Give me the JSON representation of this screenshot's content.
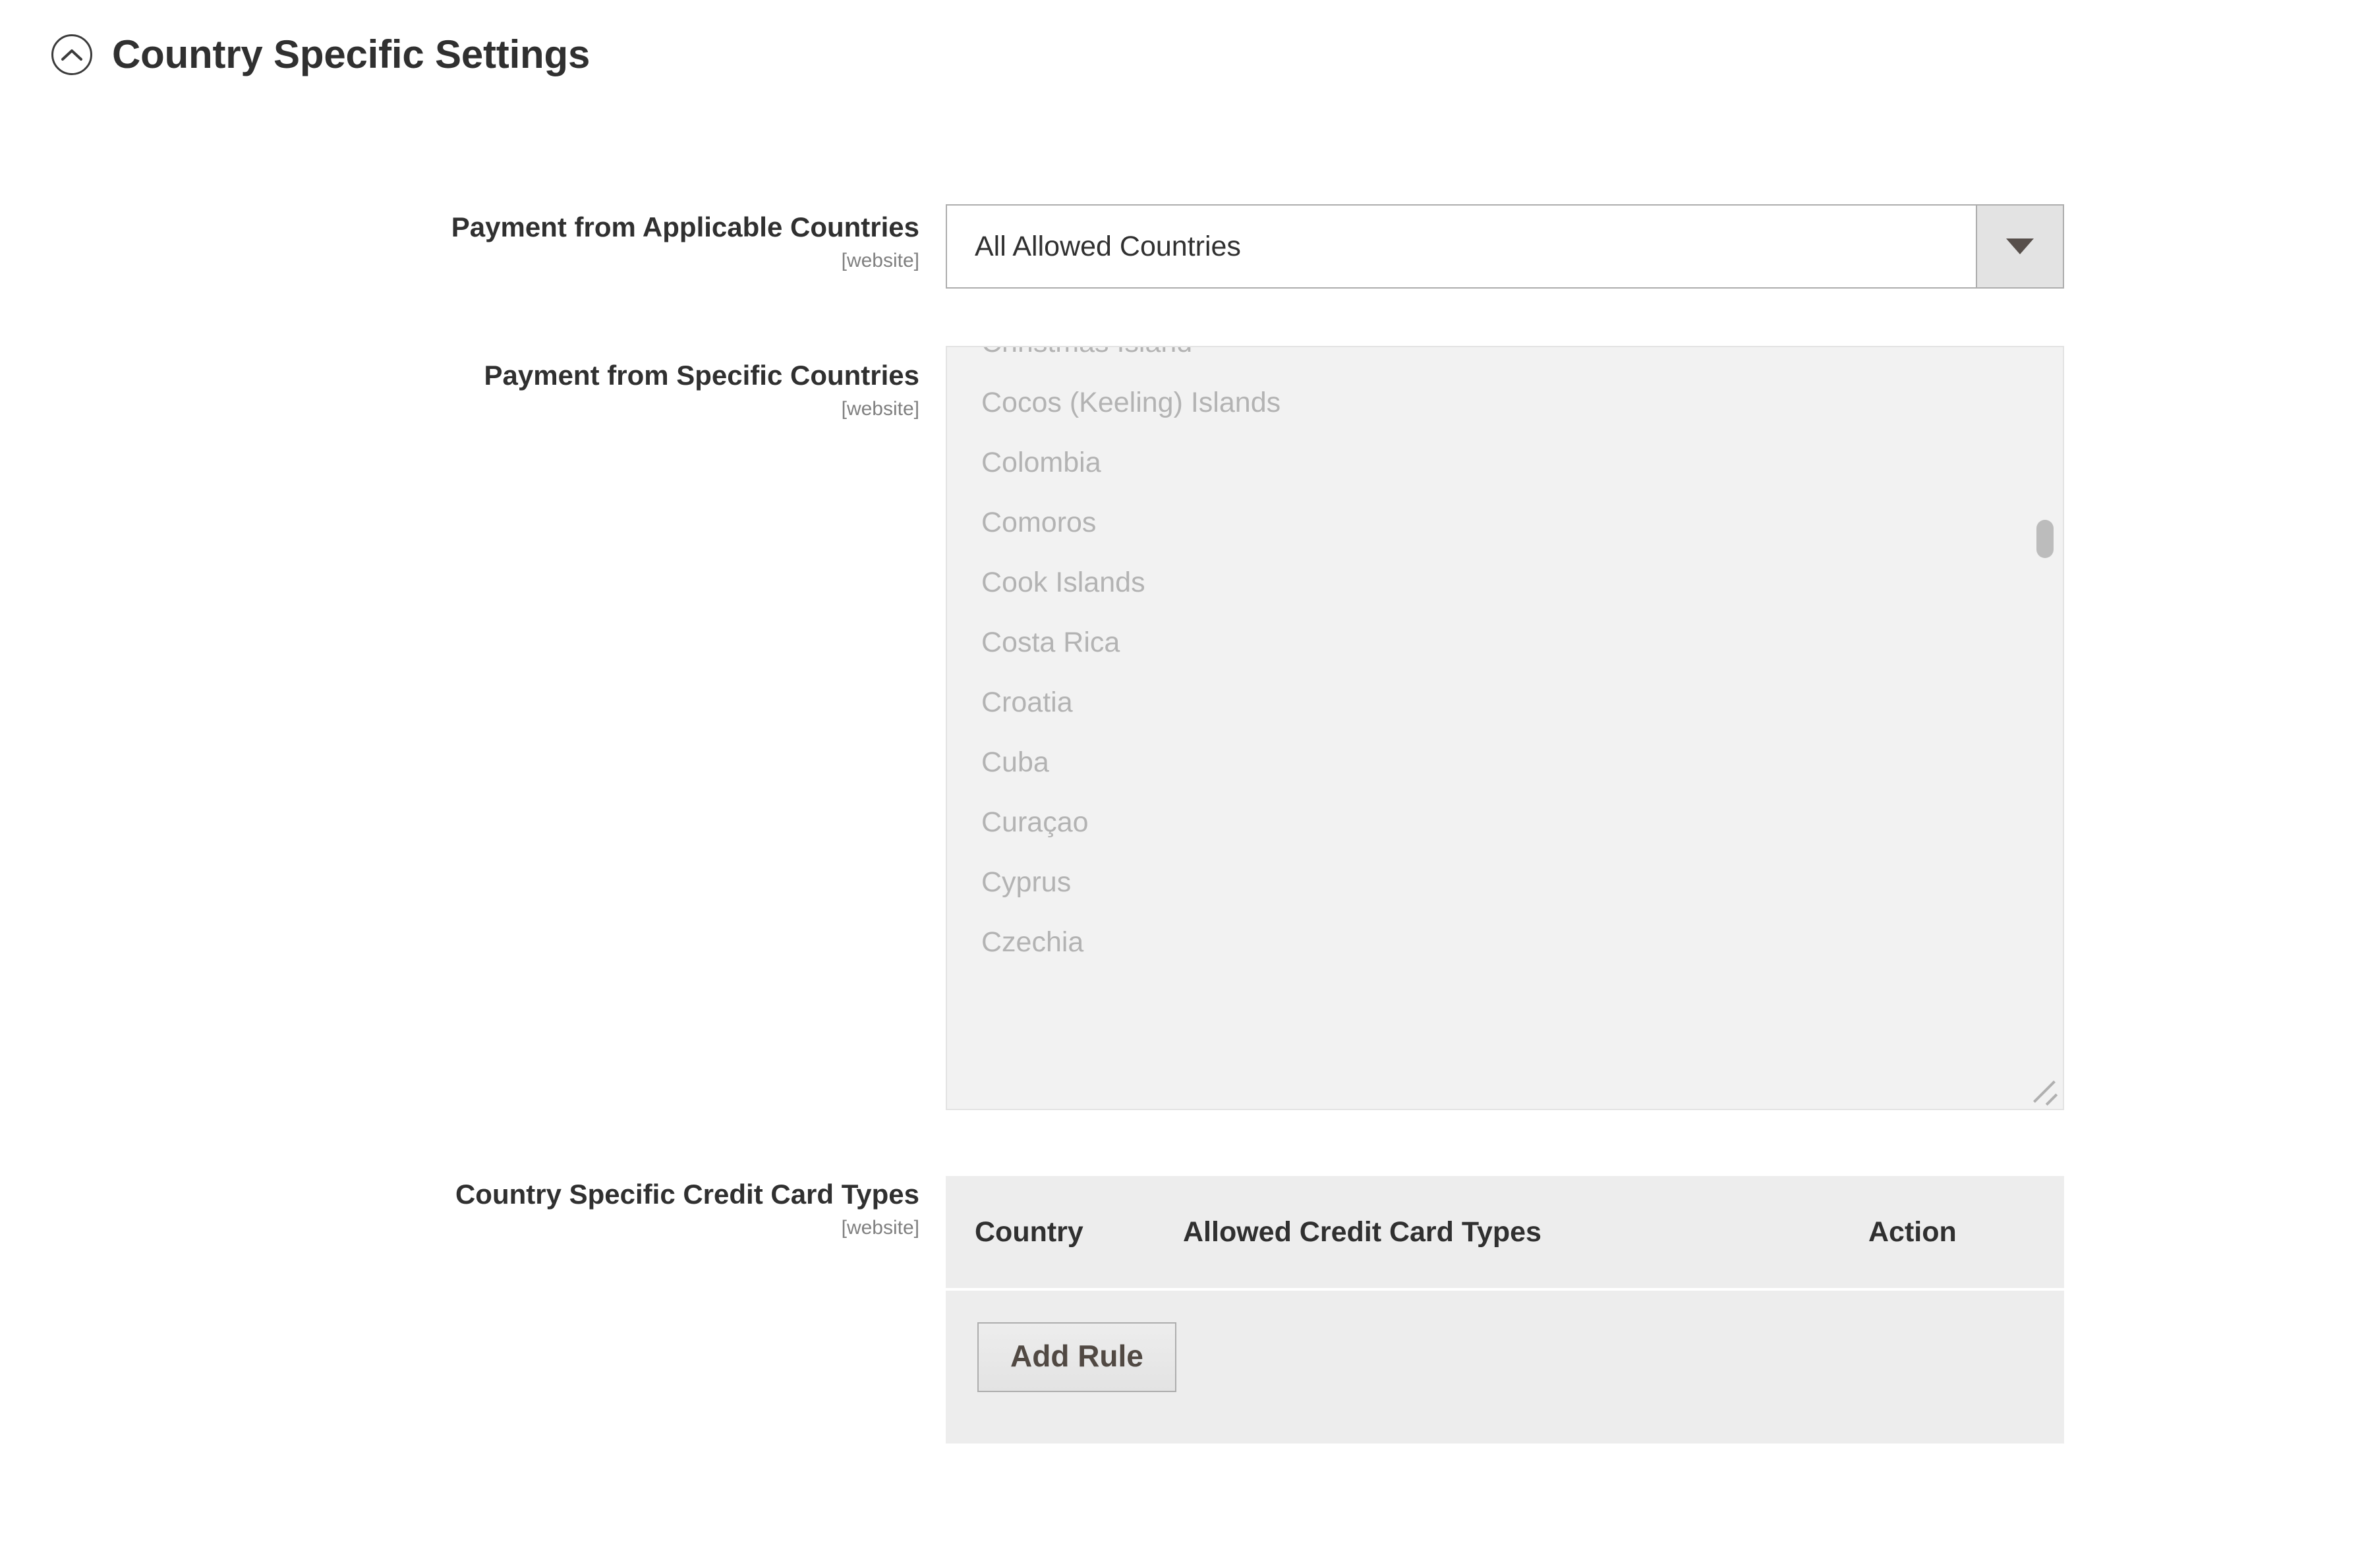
{
  "section": {
    "title": "Country Specific Settings",
    "collapse_icon": "chevron-up-circle-icon",
    "expanded": true
  },
  "fields": {
    "payment_applicable_countries": {
      "label": "Payment from Applicable Countries",
      "scope": "[website]",
      "selected_value": "All Allowed Countries",
      "dropdown_icon": "caret-down-icon"
    },
    "payment_specific_countries": {
      "label": "Payment from Specific Countries",
      "scope": "[website]",
      "disabled": true,
      "options": [
        "Christmas Island",
        "Cocos (Keeling) Islands",
        "Colombia",
        "Comoros",
        "Cook Islands",
        "Costa Rica",
        "Croatia",
        "Cuba",
        "Curaçao",
        "Cyprus",
        "Czechia"
      ],
      "resize_handle_icon": "resize-grip-icon",
      "scrollbar_icon": "scrollbar-thumb"
    },
    "country_specific_credit_card_types": {
      "label": "Country Specific Credit Card Types",
      "scope": "[website]",
      "columns": [
        "Country",
        "Allowed Credit Card Types",
        "Action"
      ],
      "rows": [],
      "add_rule_label": "Add Rule"
    }
  },
  "colors": {
    "page_background": "#ffffff",
    "text_primary": "#303030",
    "text_scope": "#808080",
    "disabled_option_text": "#b3b3b3",
    "multiselect_background": "#f2f2f2",
    "table_background": "#ededed",
    "button_border": "#adadad",
    "button_text": "#514943",
    "caret_fill": "#574f4b"
  }
}
